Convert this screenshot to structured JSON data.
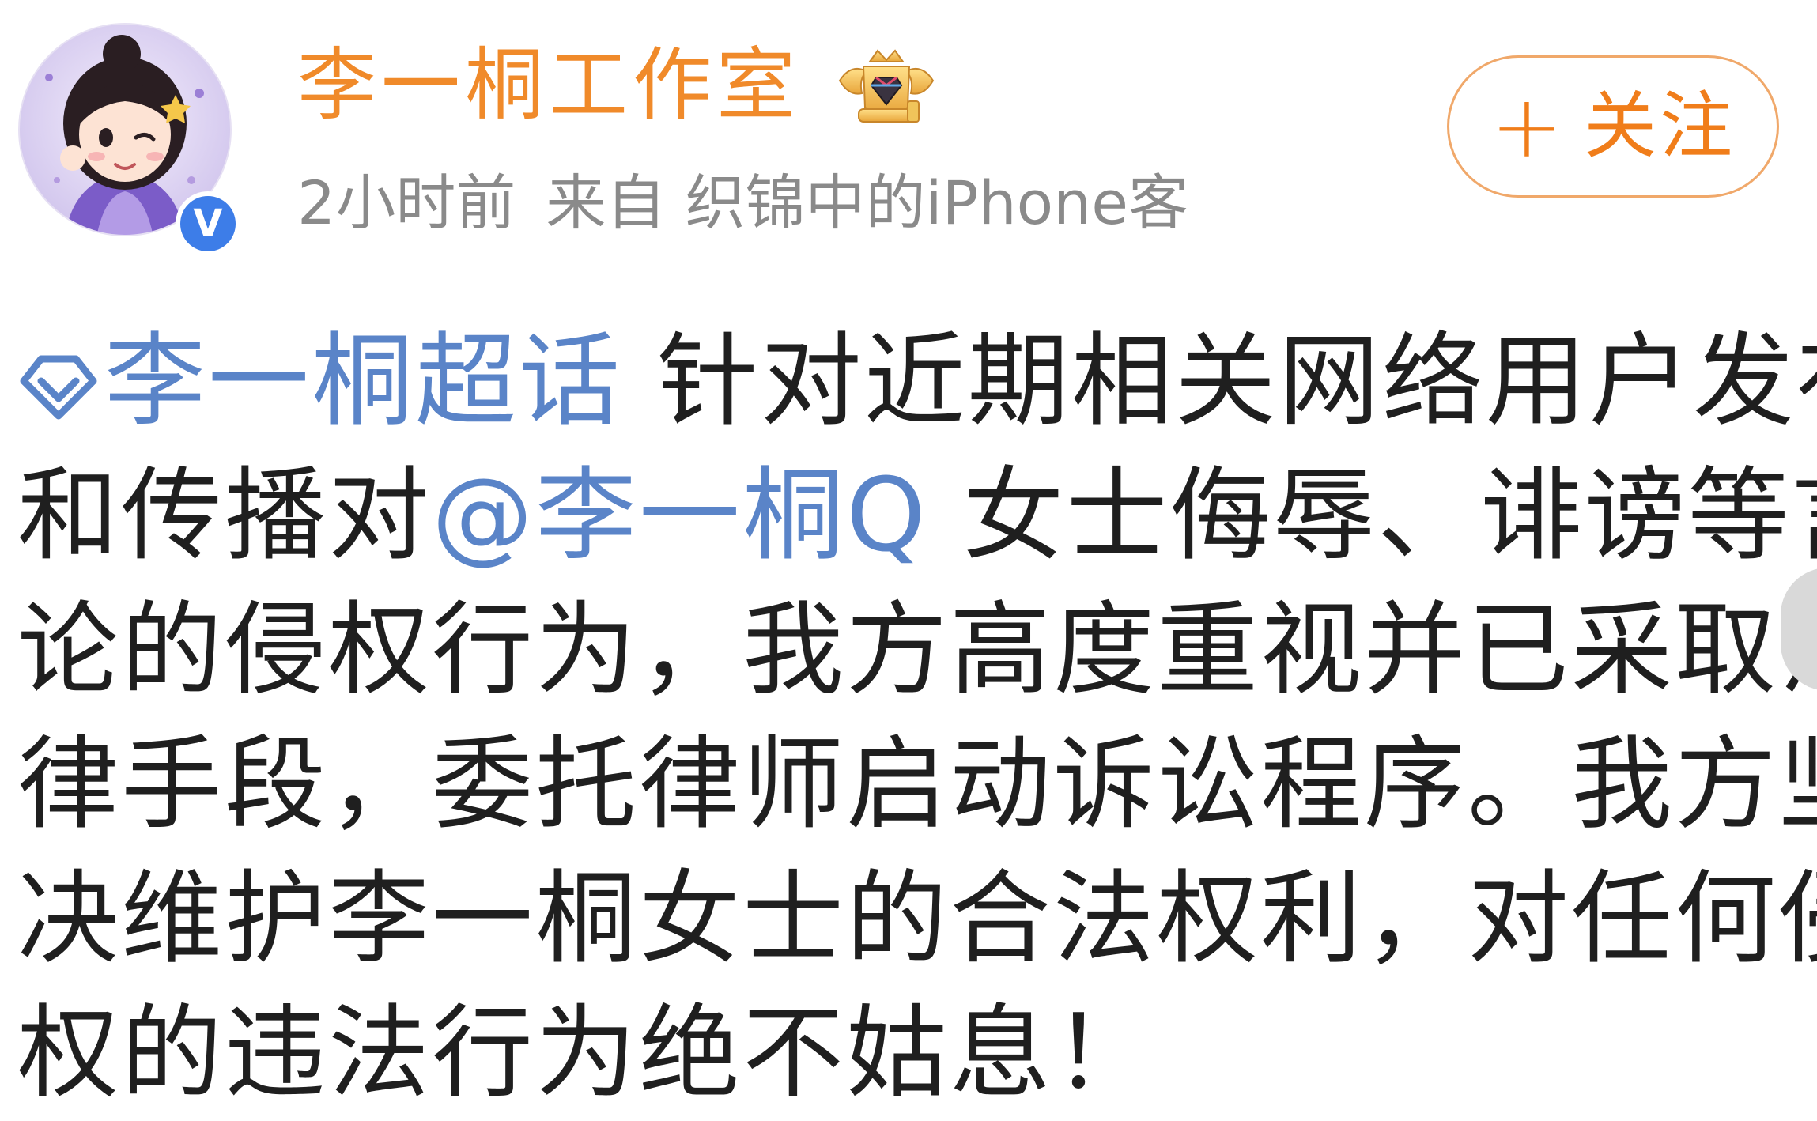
{
  "post": {
    "author": {
      "name": "李一桐工作室",
      "verified_badge": "V",
      "vip_icon": "crown-icon"
    },
    "meta": {
      "time": "2小时前",
      "source": "来自 织锦中的iPhone客"
    },
    "follow_button": {
      "plus": "+",
      "label": "关注"
    },
    "content": {
      "line1": {
        "supertopic_icon": "supertopic-diamond-icon",
        "supertopic": "李一桐超话",
        "text": " 针对近期相关网络用户发布"
      },
      "line2": {
        "before": "和传播对",
        "mention": "@李一桐Q",
        "after": " 女士侮辱、诽谤等言"
      },
      "line3": "论的侵权行为，我方高度重视并已采取法",
      "line4": "律手段，委托律师启动诉讼程序。我方坚",
      "line5": "决维护李一桐女士的合法权利，对任何侵",
      "line6": "权的违法行为绝不姑息！"
    }
  },
  "colors": {
    "username": "#f08a2a",
    "link": "#5a84c8",
    "meta": "#8a8a8a",
    "follow": "#f07d1a",
    "verified": "#3d7de8",
    "text": "#1f1f1f"
  }
}
